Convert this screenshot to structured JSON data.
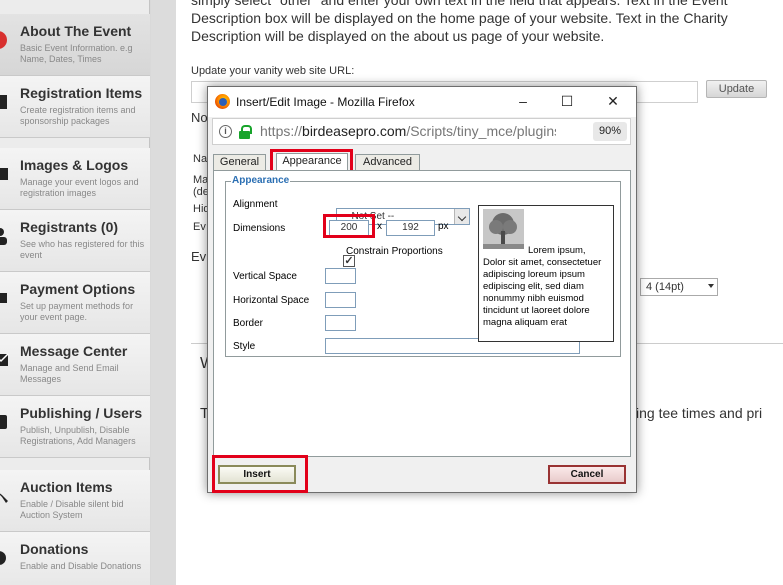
{
  "sidebar": {
    "items": [
      {
        "title": "About The Event",
        "desc": "Basic Event Information. e.g Name, Dates, Times",
        "icon": "about-icon"
      },
      {
        "title": "Registration Items",
        "desc": "Create registration items and sponsorship packages",
        "icon": "registration-icon"
      },
      {
        "title": "Images & Logos",
        "desc": "Manage your event logos and registration images",
        "icon": "image-icon"
      },
      {
        "title": "Registrants (0)",
        "desc": "See who has registered for this event",
        "icon": "people-icon"
      },
      {
        "title": "Payment Options",
        "desc": "Set up payment methods for your event page.",
        "icon": "payment-icon"
      },
      {
        "title": "Message Center",
        "desc": "Manage and Send Email Messages",
        "icon": "envelope-icon"
      },
      {
        "title": "Publishing / Users",
        "desc": "Publish, Unpublish, Disable Registrations, Add Managers",
        "icon": "publish-icon"
      },
      {
        "title": "Auction Items",
        "desc": "Enable / Disable silent bid Auction System",
        "icon": "gavel-icon"
      },
      {
        "title": "Donations",
        "desc": "Enable and Disable Donations",
        "icon": "donation-icon"
      }
    ]
  },
  "main": {
    "intro": "simply select \"other\" and enter your own text in the field that appears. Text in the Event Description box will be displayed on the home page of your website. Text in the Charity Description will be displayed on the about us page of your website.",
    "vanity_label": "Update your vanity web site URL:",
    "update_button": "Update",
    "fragments": {
      "no": "No",
      "na": "Na",
      "ma": "Ma",
      "de": "(de",
      "hid": "Hid",
      "ev1": "Ev",
      "ev2": "Ev",
      "w": "W",
      "t": "T"
    },
    "font_size_select": "4 (14pt)",
    "editor_text": "ing tee times and pri"
  },
  "popup": {
    "window_title": "Insert/Edit Image - Mozilla Firefox",
    "url_domain": "birdeasepro.com",
    "url_prefix": "https://",
    "url_path": "/Scripts/tiny_mce/plugins/adv",
    "zoom": "90%",
    "tabs": [
      "General",
      "Appearance",
      "Advanced"
    ],
    "active_tab": "Appearance",
    "legend": "Appearance",
    "fields": {
      "alignment_label": "Alignment",
      "alignment_value": "-- Not Set --",
      "dimensions_label": "Dimensions",
      "width": "200",
      "times": "x",
      "height": "192",
      "unit": "px",
      "constrain_label": "Constrain Proportions",
      "constrain_checked": true,
      "vertical_space_label": "Vertical Space",
      "horizontal_space_label": "Horizontal Space",
      "border_label": "Border",
      "style_label": "Style"
    },
    "preview_text": "Lorem ipsum, Dolor sit amet, consectetuer adipiscing loreum ipsum edipiscing elit, sed diam nonummy nibh euismod tincidunt ut laoreet dolore magna aliquam erat",
    "insert_label": "Insert",
    "cancel_label": "Cancel"
  },
  "colors": {
    "highlight": "#e2001a",
    "legend": "#2b6fb3"
  }
}
